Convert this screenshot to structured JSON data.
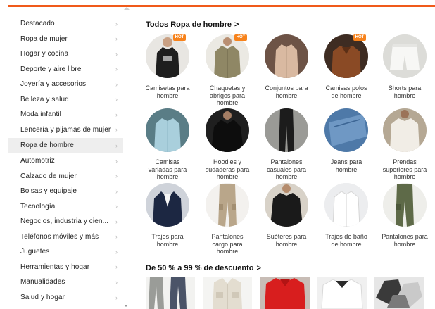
{
  "sidebar": {
    "items": [
      {
        "label": "Destacado"
      },
      {
        "label": "Ropa de mujer"
      },
      {
        "label": "Hogar y cocina"
      },
      {
        "label": "Deporte y aire libre"
      },
      {
        "label": "Joyería y accesorios"
      },
      {
        "label": "Belleza y salud"
      },
      {
        "label": "Moda infantil"
      },
      {
        "label": "Lencería y pijamas de mujer"
      },
      {
        "label": "Ropa de hombre",
        "active": true
      },
      {
        "label": "Automotriz"
      },
      {
        "label": "Calzado de mujer"
      },
      {
        "label": "Bolsas y equipaje"
      },
      {
        "label": "Tecnología"
      },
      {
        "label": "Negocios, industria y cien..."
      },
      {
        "label": "Teléfonos móviles y más"
      },
      {
        "label": "Juguetes"
      },
      {
        "label": "Herramientas y hogar"
      },
      {
        "label": "Manualidades"
      },
      {
        "label": "Salud y hogar"
      }
    ],
    "chevron_icon": "chevron-right-icon"
  },
  "main": {
    "title": "Todos Ropa de hombre",
    "title_arrow": ">",
    "badge_text": "HOT",
    "categories": [
      {
        "label": "Camisetas para hombre",
        "hot": true
      },
      {
        "label": "Chaquetas y abrigos para hombre",
        "hot": true
      },
      {
        "label": "Conjuntos para hombre",
        "hot": false
      },
      {
        "label": "Camisas polos de hombre",
        "hot": true
      },
      {
        "label": "Shorts para hombre",
        "hot": false
      },
      {
        "label": "Camisas variadas para hombre",
        "hot": false
      },
      {
        "label": "Hoodies y sudaderas para hombre",
        "hot": false
      },
      {
        "label": "Pantalones casuales para hombre",
        "hot": false
      },
      {
        "label": "Jeans para hombre",
        "hot": false
      },
      {
        "label": "Prendas superiores para hombre",
        "hot": false
      },
      {
        "label": "Trajes para hombre",
        "hot": false
      },
      {
        "label": "Pantalones cargo para hombre",
        "hot": false
      },
      {
        "label": "Suéteres para hombre",
        "hot": false
      },
      {
        "label": "Trajes de baño de hombre",
        "hot": false
      },
      {
        "label": "Pantalones para hombre",
        "hot": false
      }
    ],
    "deals_title": "De 50 % a 99 % de descuento",
    "deals_arrow": ">"
  },
  "colors": {
    "accent": "#f05a1a",
    "hot_badge": "#f7821b",
    "active_row": "#eeeeee"
  }
}
